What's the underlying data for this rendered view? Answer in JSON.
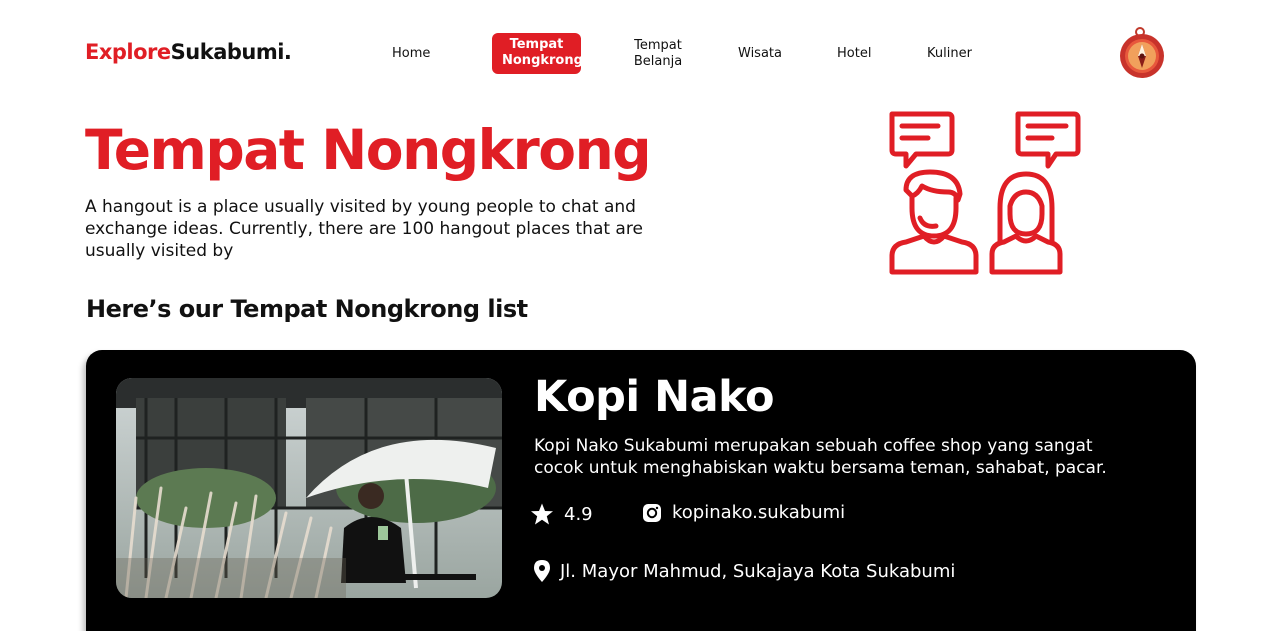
{
  "brand": {
    "part1": "Explore",
    "part2": "Sukabumi."
  },
  "nav": {
    "home": "Home",
    "tempat_nongkrong_1": "Tempat",
    "tempat_nongkrong_2": "Nongkrong",
    "tempat_belanja_1": "Tempat",
    "tempat_belanja_2": "Belanja",
    "wisata": "Wisata",
    "hotel": "Hotel",
    "kuliner": "Kuliner",
    "active": "Tempat Nongkrong"
  },
  "hero": {
    "title": "Tempat Nongkrong",
    "description": "A hangout is a place usually visited by young people to chat and exchange ideas. Currently, there are 100 hangout places that are usually visited by",
    "illustration_icon": "people-chatting-icon"
  },
  "list": {
    "heading": "Here’s our Tempat Nongkrong list"
  },
  "place": {
    "name": "Kopi Nako",
    "description": "Kopi Nako Sukabumi merupakan sebuah coffee shop yang sangat cocok untuk menghabiskan waktu bersama teman, sahabat, pacar.",
    "rating": "4.9",
    "instagram": "kopinako.sukabumi",
    "address": "Jl. Mayor Mahmud, Sukajaya Kota Sukabumi"
  },
  "colors": {
    "accent": "#e01e25",
    "card_bg": "#000000",
    "text": "#111111"
  }
}
